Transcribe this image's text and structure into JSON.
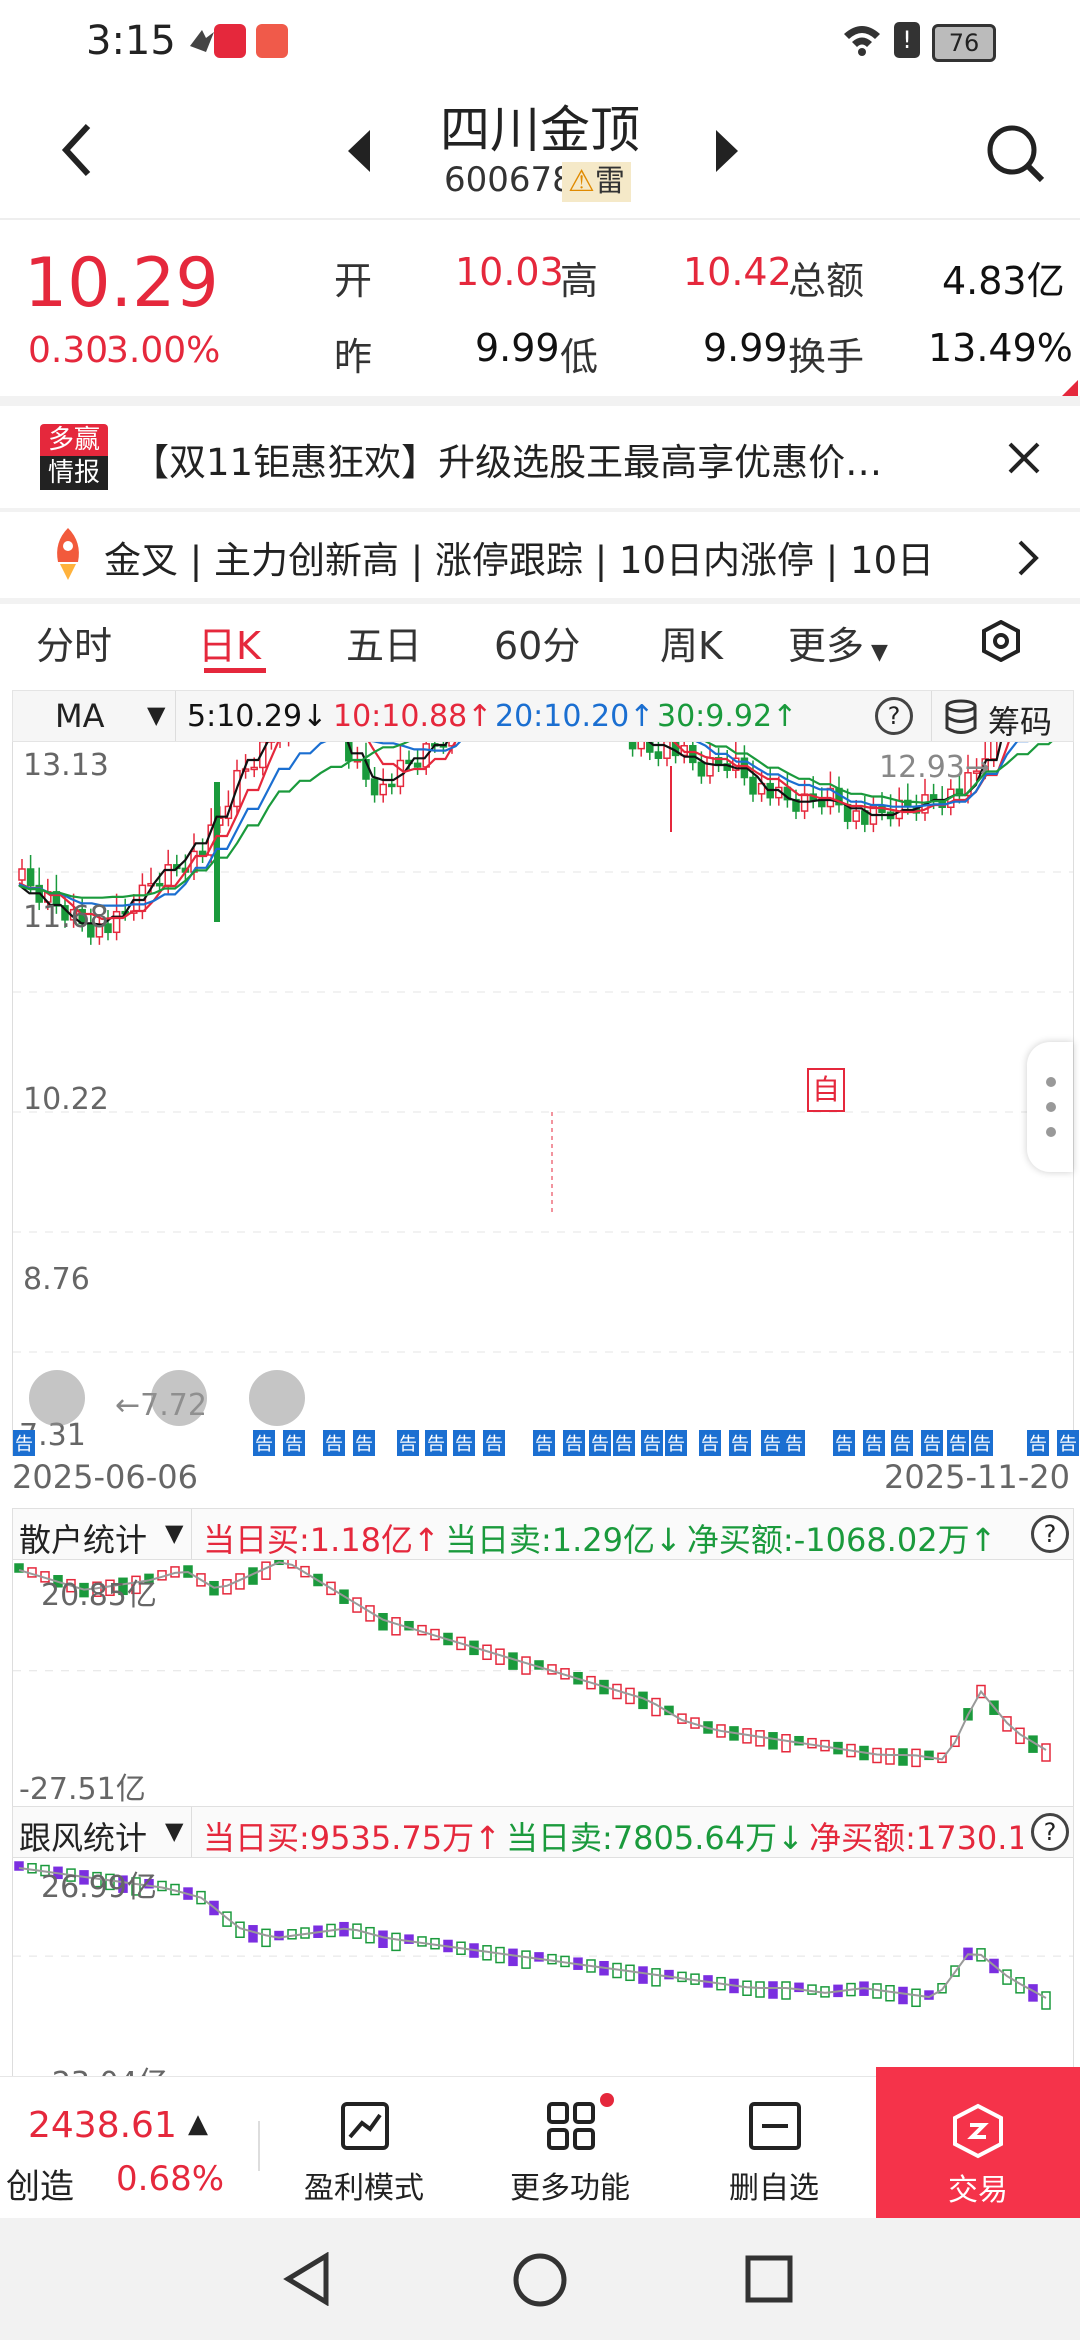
{
  "status_bar": {
    "time": "3:15",
    "battery": "76"
  },
  "header": {
    "stock_name": "四川金顶",
    "stock_code": "600678",
    "risk_badge": "雷"
  },
  "quote": {
    "price": "10.29",
    "change": "0.30",
    "change_pct": "3.00%",
    "open_label": "开",
    "open": "10.03",
    "high_label": "高",
    "high": "10.42",
    "amount_label": "总额",
    "amount": "4.83亿",
    "prev_label": "昨",
    "prev": "9.99",
    "low_label": "低",
    "low": "9.99",
    "turnover_label": "换手",
    "turnover": "13.49%"
  },
  "news": {
    "source_top": "多赢",
    "source_bottom": "情报",
    "text": "【双11钜惠狂欢】升级选股王最高享优惠价…"
  },
  "ticker": {
    "text": "金叉 | 主力创新高 | 涨停跟踪 | 10日内涨停 | 10日"
  },
  "tabs": [
    "分时",
    "日K",
    "五日",
    "60分",
    "周K",
    "更多"
  ],
  "ma_bar": {
    "label": "MA",
    "ma5": "5:10.29↓",
    "ma10": "10:10.88↑",
    "ma20": "20:10.20↑",
    "ma30": "30:9.92↑",
    "chips_label": "筹码"
  },
  "kline": {
    "y_labels": [
      "13.13",
      "11.68",
      "10.22",
      "8.76",
      "7.31"
    ],
    "high_marker": "12.93→",
    "low_marker": "←7.72",
    "self_marker": "自",
    "notice_label": "告",
    "date_start": "2025-06-06",
    "date_end": "2025-11-20"
  },
  "retail": {
    "title": "散户统计",
    "buy": "当日买:1.18亿↑",
    "sell": "当日卖:1.29亿↓",
    "net": "净买额:-1068.02万↑",
    "y_top": "20.85亿",
    "y_bottom": "-27.51亿"
  },
  "follow": {
    "title": "跟风统计",
    "buy": "当日买:9535.75万↑",
    "sell": "当日卖:7805.64万↓",
    "net": "净买额:1730.1",
    "y_top": "26.99亿",
    "y_bottom": "-23.04亿"
  },
  "bottom": {
    "index_value": "2438.61",
    "index_name": "创造",
    "index_pct": "0.68%",
    "btn1": "盈利模式",
    "btn2": "更多功能",
    "btn3": "删自选",
    "btn4": "交易"
  },
  "colors": {
    "up": "#e5283c",
    "down": "#1a9a3c",
    "ma5": "#111111",
    "ma10": "#e5283c",
    "ma20": "#1b6fd1",
    "ma30": "#1a9a3c",
    "trade": "#f5334a"
  }
}
